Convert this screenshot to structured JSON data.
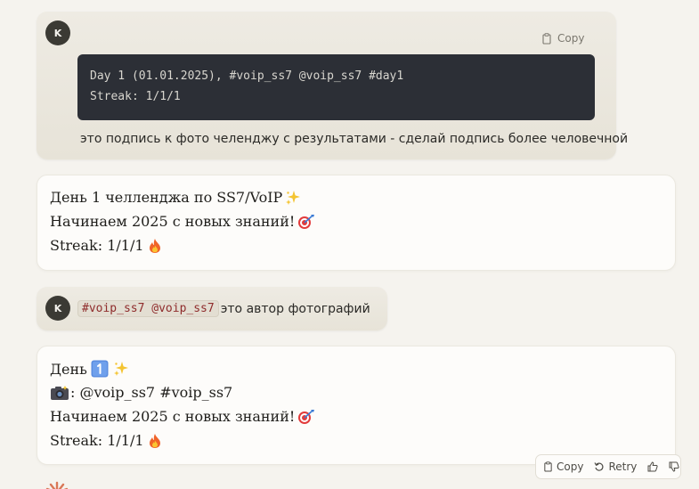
{
  "messages": {
    "user1": {
      "avatar_letter": "K",
      "copy_label": "Copy",
      "code_lines": [
        "Day 1 (01.01.2025), #voip_ss7 @voip_ss7 #day1",
        "Streak: 1/1/1"
      ],
      "text": "это подпись к фото челенджу с результатами - сделай подпись более человечной"
    },
    "assistant1": {
      "lines": [
        "День 1 челленджа по SS7/VoIP",
        "Начинаем 2025 с новых знаний!",
        "Streak: 1/1/1"
      ]
    },
    "user2": {
      "avatar_letter": "K",
      "code": "#voip_ss7 @voip_ss7",
      "text": "это автор фотографий"
    },
    "assistant2": {
      "lines": [
        "День",
        ": @voip_ss7 #voip_ss7",
        "Начинаем 2025 с новых знаний!",
        "Streak: 1/1/1"
      ]
    }
  },
  "actions": {
    "copy_label": "Copy",
    "retry_label": "Retry"
  },
  "icons": [
    "clipboard-icon",
    "retry-icon",
    "thumbs-up-icon",
    "thumbs-down-icon",
    "sparkles-icon",
    "target-icon",
    "fire-icon",
    "camera-icon",
    "keycap-one-icon",
    "claude-logo-icon"
  ]
}
